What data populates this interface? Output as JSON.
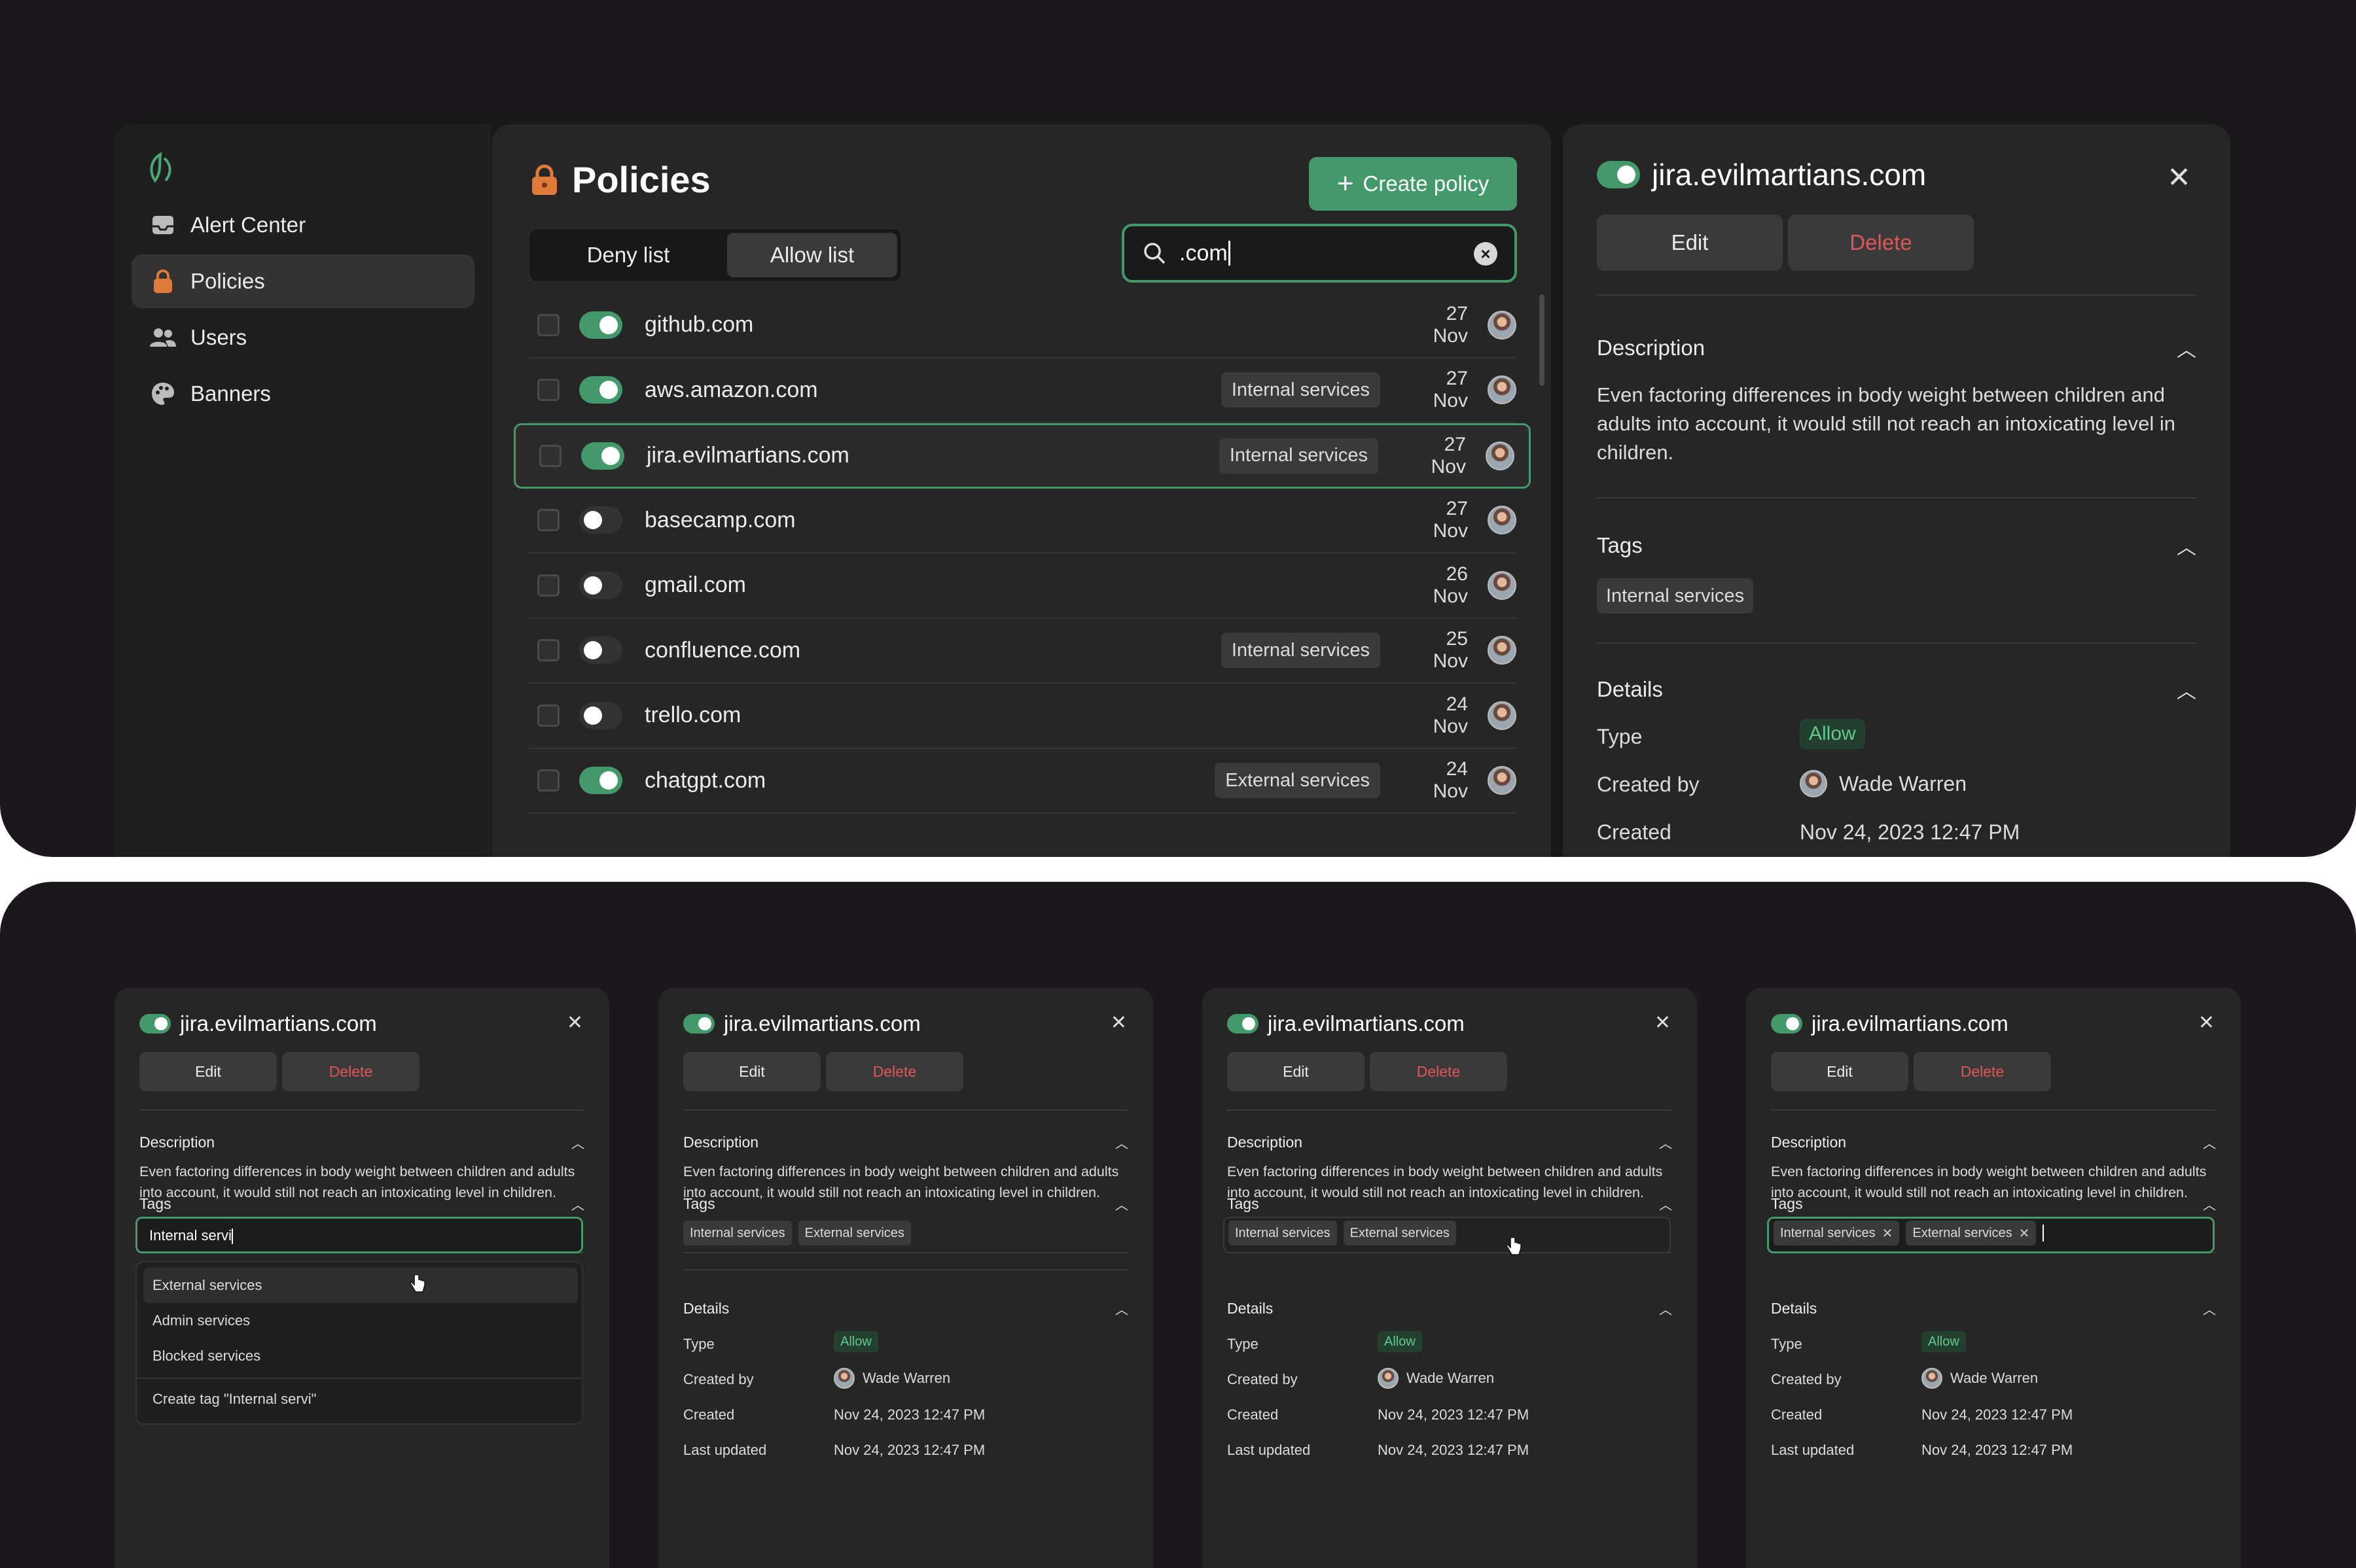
{
  "colors": {
    "accent": "#43996a",
    "danger": "#e05656",
    "background": "#1c171c",
    "panel": "#262626",
    "sidebar": "#1f1f1f",
    "policy_lock": "#e07a3a",
    "allow_badge_text": "#63c98c"
  },
  "sidebar": {
    "logo_icon": "leaf-logo",
    "items": [
      {
        "label": "Alert Center",
        "icon": "inbox-icon"
      },
      {
        "label": "Policies",
        "icon": "lock-icon",
        "active": true
      },
      {
        "label": "Users",
        "icon": "users-icon"
      },
      {
        "label": "Banners",
        "icon": "palette-icon"
      }
    ]
  },
  "main": {
    "title": "Policies",
    "create_label": "Create policy",
    "tabs": [
      {
        "label": "Deny list",
        "active": false
      },
      {
        "label": "Allow list",
        "active": true
      }
    ],
    "search": {
      "value": ".com"
    },
    "rows": [
      {
        "domain": "github.com",
        "enabled": true,
        "tag": "",
        "date": "27 Nov"
      },
      {
        "domain": "aws.amazon.com",
        "enabled": true,
        "tag": "Internal services",
        "date": "27 Nov"
      },
      {
        "domain": "jira.evilmartians.com",
        "enabled": true,
        "tag": "Internal services",
        "date": "27 Nov",
        "selected": true
      },
      {
        "domain": "basecamp.com",
        "enabled": false,
        "tag": "",
        "date": "27 Nov"
      },
      {
        "domain": "gmail.com",
        "enabled": false,
        "tag": "",
        "date": "26 Nov"
      },
      {
        "domain": "confluence.com",
        "enabled": false,
        "tag": "Internal services",
        "date": "25 Nov"
      },
      {
        "domain": "trello.com",
        "enabled": false,
        "tag": "",
        "date": "24 Nov"
      },
      {
        "domain": "chatgpt.com",
        "enabled": true,
        "tag": "External services",
        "date": "24 Nov"
      }
    ]
  },
  "detail": {
    "title": "jira.evilmartians.com",
    "enabled": true,
    "edit_label": "Edit",
    "delete_label": "Delete",
    "description_heading": "Description",
    "description": "Even factoring differences in body weight between children and adults into account, it would still not reach an intoxicating level in children.",
    "tags_heading": "Tags",
    "tags": [
      "Internal services"
    ],
    "details_heading": "Details",
    "type_label": "Type",
    "type_value": "Allow",
    "created_by_label": "Created by",
    "created_by_value": "Wade Warren",
    "created_label": "Created",
    "created_value": "Nov 24, 2023 12:47 PM"
  },
  "cards": {
    "title": "jira.evilmartians.com",
    "edit_label": "Edit",
    "delete_label": "Delete",
    "description_heading": "Description",
    "description": "Even factoring differences in body weight between children and adults into account, it would still not reach an intoxicating level in children.",
    "tags_heading": "Tags",
    "details_heading": "Details",
    "type_label": "Type",
    "type_value": "Allow",
    "created_by_label": "Created by",
    "created_by_value": "Wade Warren",
    "created_label": "Created",
    "created_value": "Nov 24, 2023 12:47 PM",
    "last_updated_label": "Last updated",
    "last_updated_value": "Nov 24, 2023 12:47 PM",
    "tag_input_value": "Internal servi",
    "dropdown": [
      "External services",
      "Admin services",
      "Blocked services"
    ],
    "create_tag_label": "Create tag \"Internal servi\"",
    "tag_internal": "Internal services",
    "tag_external": "External services"
  }
}
